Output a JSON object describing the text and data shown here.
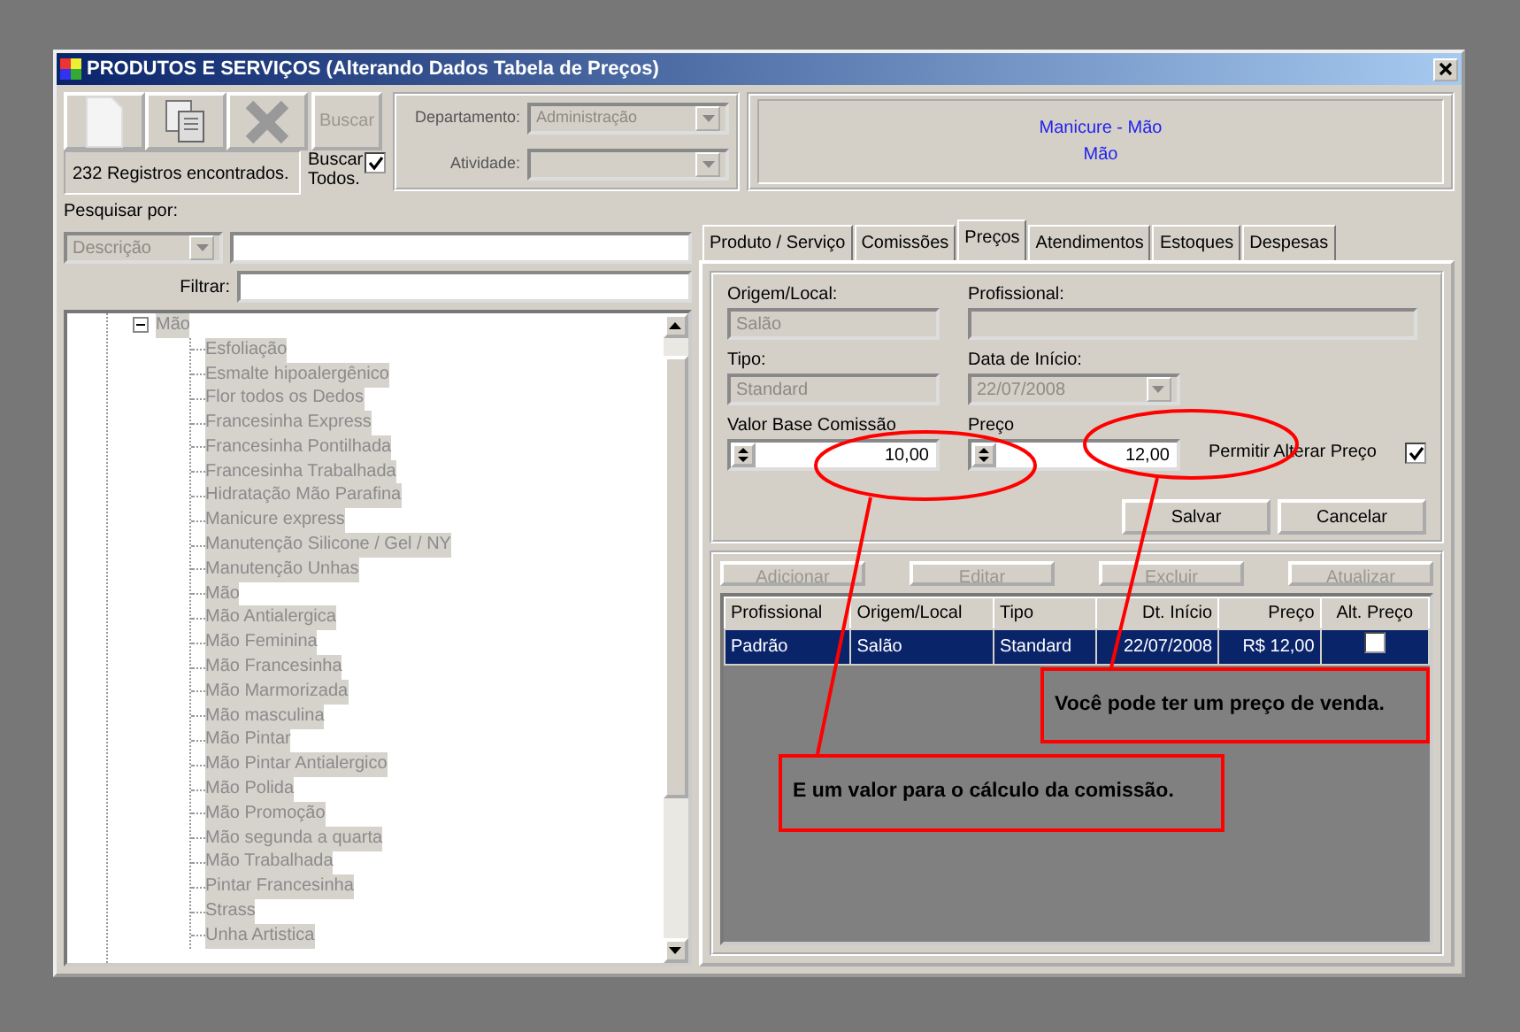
{
  "window": {
    "title": "PRODUTOS E SERVIÇOS (Alterando Dados Tabela de Preços)"
  },
  "search_button": {
    "label": "Buscar",
    "disabled": true
  },
  "record_count": "232 Registros encontrados.",
  "search_all": {
    "label": "Buscar Todos.",
    "checked": true
  },
  "filters": [
    {
      "label": "Departamento:",
      "value": "Administração",
      "disabled": true
    },
    {
      "label": "Atividade:",
      "disabled": true
    }
  ],
  "info_panel": {
    "lines": [
      "Manicure - Mão",
      "Mão"
    ]
  },
  "search": {
    "label": "Pesquisar por:",
    "field": "Descrição",
    "filter_label": "Filtrar:"
  },
  "tree": [
    {
      "label": "Mão",
      "expanded": true,
      "children": [
        {
          "label": "Esfoliação"
        },
        {
          "label": "Esmalte hipoalergênico"
        },
        {
          "label": "Flor todos os Dedos"
        },
        {
          "label": "Francesinha Express"
        },
        {
          "label": "Francesinha Pontilhada"
        },
        {
          "label": "Francesinha Trabalhada"
        },
        {
          "label": "Hidratação Mão Parafina"
        },
        {
          "label": "Manicure express"
        },
        {
          "label": "Manutenção Silicone / Gel / NY"
        },
        {
          "label": "Manutenção Unhas"
        },
        {
          "label": "Mão"
        },
        {
          "label": "Mão Antialergica"
        },
        {
          "label": "Mão Feminina"
        },
        {
          "label": "Mão Francesinha"
        },
        {
          "label": "Mão Marmorizada"
        },
        {
          "label": "Mão masculina"
        },
        {
          "label": "Mão Pintar"
        },
        {
          "label": "Mão Pintar Antialergico"
        },
        {
          "label": "Mão Polida"
        },
        {
          "label": "Mão Promoção"
        },
        {
          "label": "Mão segunda a quarta"
        },
        {
          "label": "Mão Trabalhada"
        },
        {
          "label": "Pintar Francesinha"
        },
        {
          "label": "Strass"
        },
        {
          "label": "Unha Artistica"
        }
      ]
    }
  ],
  "tabs": [
    {
      "label": "Produto / Serviço",
      "selected": false
    },
    {
      "label": "Comissões",
      "selected": false
    },
    {
      "label": "Preços",
      "selected": true
    },
    {
      "label": "Atendimentos",
      "selected": false
    },
    {
      "label": "Estoques",
      "selected": false
    },
    {
      "label": "Despesas",
      "selected": false
    }
  ],
  "form": {
    "origin_label": "Origem/Local:",
    "origin": "Salão",
    "professional_label": "Profissional:",
    "type_label": "Tipo:",
    "type": "Standard",
    "start_label": "Data de Início:",
    "start": "22/07/2008",
    "base_label": "Valor Base Comissão",
    "base": "10,00",
    "price_label": "Preço",
    "price": "12,00",
    "allow_label": "Permitir Alterar Preço",
    "allow_checked": true
  },
  "form_buttons": [
    {
      "label": "Salvar",
      "disabled": false
    },
    {
      "label": "Cancelar",
      "disabled": false
    }
  ],
  "grid_buttons": [
    {
      "label": "Adicionar",
      "disabled": true
    },
    {
      "label": "Editar",
      "disabled": true
    },
    {
      "label": "Excluir",
      "disabled": true
    },
    {
      "label": "Atualizar",
      "disabled": true
    }
  ],
  "table": {
    "columns": [
      "Profissional",
      "Origem/Local",
      "Tipo",
      "Dt. Início",
      "Preço",
      "Alt. Preço"
    ],
    "rows": [
      {
        "cells": [
          "Padrão",
          "Salão",
          "Standard",
          "22/07/2008",
          "R$ 12,00"
        ],
        "alt_price": false,
        "selected": true
      }
    ]
  },
  "callouts": [
    {
      "text": "Você pode ter um preço de venda."
    },
    {
      "text": "E um valor para o cálculo da comissão."
    }
  ]
}
